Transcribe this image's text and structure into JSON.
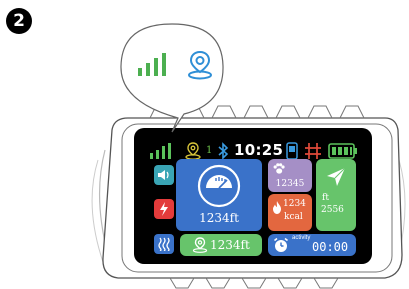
{
  "step_number": "2",
  "zoom_bubble": {
    "icons": [
      "signal-bars-icon",
      "location-pin-icon"
    ]
  },
  "status_bar": {
    "location_count": "1",
    "time": "10:25",
    "icons": [
      "signal-bars-icon",
      "location-pin-icon",
      "bluetooth-icon",
      "phone-icon",
      "grid-icon",
      "battery-icon"
    ]
  },
  "tiles": {
    "main": {
      "value": "1234ft",
      "icon": "gauge-icon"
    },
    "paw": {
      "value": "12345",
      "icon": "paw-icon"
    },
    "calories": {
      "value": "1234",
      "unit": "kcal",
      "icon": "flame-icon"
    },
    "navigation": {
      "unit": "ft",
      "value": "2556",
      "icon": "send-arrow-icon"
    },
    "location": {
      "value": "1234ft",
      "icon": "location-pin-icon"
    },
    "activity": {
      "label": "activity",
      "value": "00:00",
      "icon": "alarm-clock-icon"
    }
  },
  "side_buttons": [
    "speaker-icon",
    "flash-icon",
    "vibrate-icon"
  ],
  "colors": {
    "green": "#67c46b",
    "blue": "#3a72c9",
    "purple": "#a58fc6",
    "orange": "#e3673f",
    "red": "#e33b3b",
    "teal": "#3aa5b5"
  }
}
